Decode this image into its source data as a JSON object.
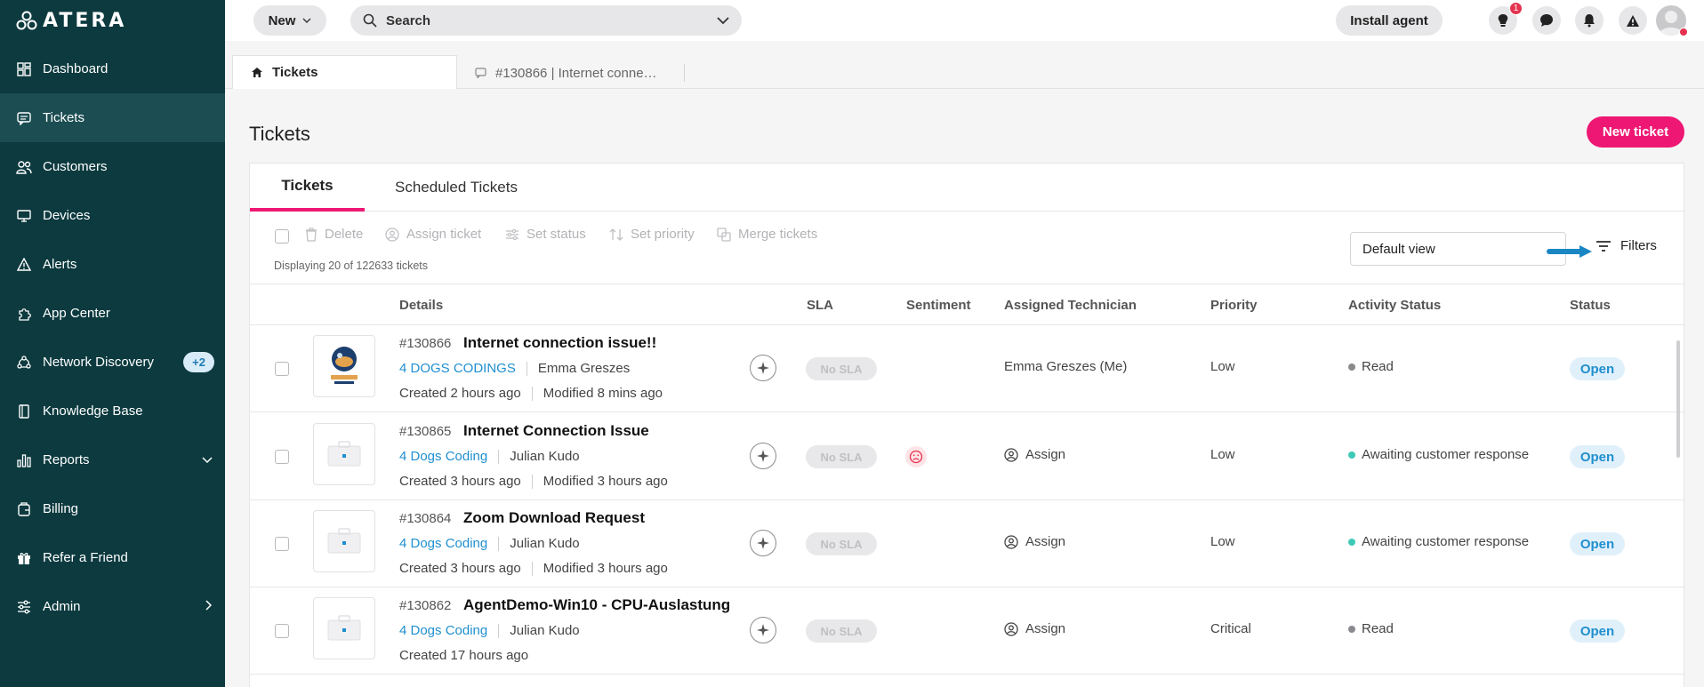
{
  "brand": {
    "name": "ATERA"
  },
  "sidebar": {
    "items": [
      {
        "label": "Dashboard",
        "icon": "dashboard-icon"
      },
      {
        "label": "Tickets",
        "icon": "tickets-icon",
        "active": true
      },
      {
        "label": "Customers",
        "icon": "customers-icon"
      },
      {
        "label": "Devices",
        "icon": "devices-icon"
      },
      {
        "label": "Alerts",
        "icon": "alert-icon"
      },
      {
        "label": "App Center",
        "icon": "app-center-icon"
      },
      {
        "label": "Network Discovery",
        "icon": "network-icon",
        "badge": "+2"
      },
      {
        "label": "Knowledge Base",
        "icon": "book-icon"
      },
      {
        "label": "Reports",
        "icon": "reports-icon",
        "chevron": "down"
      },
      {
        "label": "Billing",
        "icon": "billing-icon"
      },
      {
        "label": "Refer a Friend",
        "icon": "gift-icon"
      },
      {
        "label": "Admin",
        "icon": "sliders-icon",
        "chevron": "right"
      }
    ]
  },
  "topbar": {
    "new_label": "New",
    "search_placeholder": "Search",
    "install_label": "Install agent",
    "notification_count": "1"
  },
  "pagetabs": {
    "home": "Tickets",
    "open_ticket": "#130866 | Internet conne…"
  },
  "main": {
    "title": "Tickets",
    "new_ticket_label": "New ticket",
    "tabs": [
      "Tickets",
      "Scheduled Tickets"
    ],
    "toolbar": {
      "delete": "Delete",
      "assign": "Assign ticket",
      "set_status": "Set status",
      "set_priority": "Set priority",
      "merge": "Merge tickets",
      "displaying": "Displaying 20 of 122633 tickets",
      "view": "Default view",
      "filters": "Filters"
    },
    "columns": {
      "details": "Details",
      "sla": "SLA",
      "sentiment": "Sentiment",
      "technician": "Assigned Technician",
      "priority": "Priority",
      "activity": "Activity Status",
      "status": "Status"
    },
    "rows": [
      {
        "number": "#130866",
        "title": "Internet connection issue!!",
        "customer": "4 DOGS CODINGS",
        "contact": "Emma Greszes",
        "created": "Created 2 hours ago",
        "modified": "Modified 8 mins ago",
        "sla": "No SLA",
        "sentiment": "",
        "technician": "Emma Greszes (Me)",
        "priority": "Low",
        "activity": "Read",
        "activity_color": "#8a8a8e",
        "status": "Open"
      },
      {
        "number": "#130865",
        "title": "Internet Connection Issue",
        "customer": "4 Dogs Coding",
        "contact": "Julian Kudo",
        "created": "Created 3 hours ago",
        "modified": "Modified 3 hours ago",
        "sla": "No SLA",
        "sentiment": "sad-face-icon",
        "technician": "Assign",
        "priority": "Low",
        "activity": "Awaiting customer response",
        "activity_color": "#3ec9b6",
        "status": "Open"
      },
      {
        "number": "#130864",
        "title": "Zoom Download Request",
        "customer": "4 Dogs Coding",
        "contact": "Julian Kudo",
        "created": "Created 3 hours ago",
        "modified": "Modified 3 hours ago",
        "sla": "No SLA",
        "sentiment": "",
        "technician": "Assign",
        "priority": "Low",
        "activity": "Awaiting customer response",
        "activity_color": "#3ec9b6",
        "status": "Open"
      },
      {
        "number": "#130862",
        "title": "AgentDemo-Win10 - CPU-Auslastung",
        "customer": "4 Dogs Coding",
        "contact": "Julian Kudo",
        "created": "Created 17 hours ago",
        "modified": "",
        "sla": "No SLA",
        "sentiment": "",
        "technician": "Assign",
        "priority": "Critical",
        "activity": "Read",
        "activity_color": "#8a8a8e",
        "status": "Open"
      }
    ]
  },
  "colors": {
    "accent": "#ee1874",
    "sidebar": "#0c3a3f",
    "link": "#1f8fcf"
  }
}
